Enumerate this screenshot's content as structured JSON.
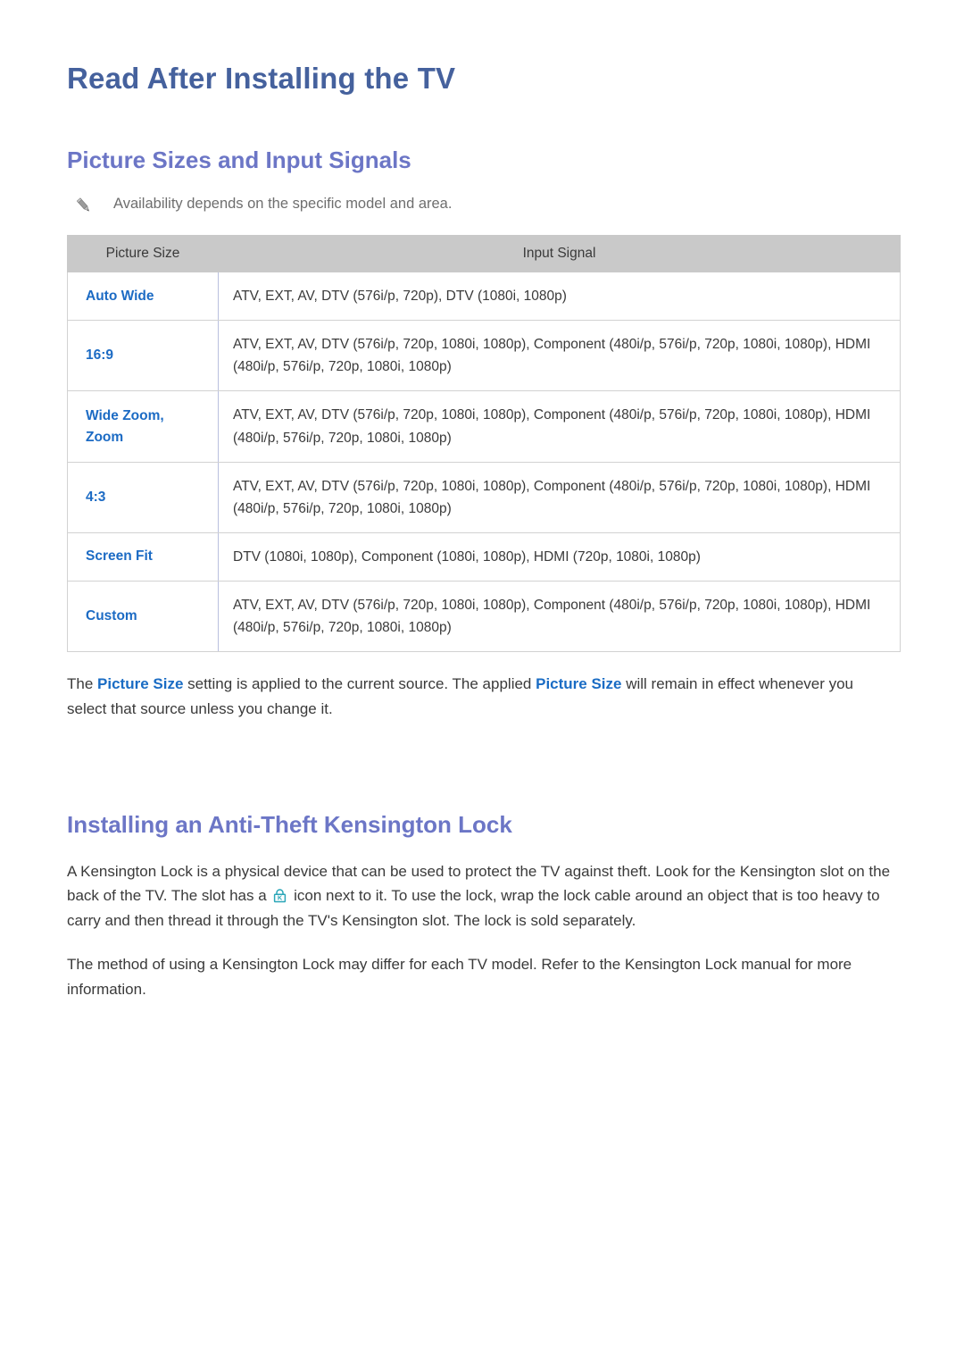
{
  "document": {
    "title": "Read After Installing the TV"
  },
  "sections": {
    "picture_sizes": {
      "heading": "Picture Sizes and Input Signals",
      "note": {
        "icon": "pencil-icon",
        "text": "Availability depends on the specific model and area."
      },
      "table": {
        "headers": [
          "Picture Size",
          "Input Signal"
        ],
        "rows": [
          {
            "size": "Auto Wide",
            "size_lines": [
              "Auto Wide"
            ],
            "signal": "ATV, EXT, AV, DTV (576i/p, 720p), DTV (1080i, 1080p)"
          },
          {
            "size": "16:9",
            "size_lines": [
              "16:9"
            ],
            "signal": "ATV, EXT, AV, DTV (576i/p, 720p, 1080i, 1080p), Component (480i/p, 576i/p, 720p, 1080i, 1080p), HDMI (480i/p, 576i/p, 720p, 1080i, 1080p)"
          },
          {
            "size": "Wide Zoom, Zoom",
            "size_lines": [
              "Wide Zoom,",
              "Zoom"
            ],
            "signal": "ATV, EXT, AV, DTV (576i/p, 720p, 1080i, 1080p), Component (480i/p, 576i/p, 720p, 1080i, 1080p), HDMI (480i/p, 576i/p, 720p, 1080i, 1080p)"
          },
          {
            "size": "4:3",
            "size_lines": [
              "4:3"
            ],
            "signal": "ATV, EXT, AV, DTV (576i/p, 720p, 1080i, 1080p), Component (480i/p, 576i/p, 720p, 1080i, 1080p), HDMI (480i/p, 576i/p, 720p, 1080i, 1080p)"
          },
          {
            "size": "Screen Fit",
            "size_lines": [
              "Screen Fit"
            ],
            "signal": "DTV (1080i, 1080p), Component (1080i, 1080p), HDMI (720p, 1080i, 1080p)"
          },
          {
            "size": "Custom",
            "size_lines": [
              "Custom"
            ],
            "signal": "ATV, EXT, AV, DTV (576i/p, 720p, 1080i, 1080p), Component (480i/p, 576i/p, 720p, 1080i, 1080p), HDMI (480i/p, 576i/p, 720p, 1080i, 1080p)"
          }
        ]
      },
      "paragraph": {
        "part1": "The ",
        "highlight1": "Picture Size",
        "part2": " setting is applied to the current source. The applied ",
        "highlight2": "Picture Size",
        "part3": " will remain in effect whenever you select that source unless you change it."
      }
    },
    "kensington": {
      "heading": "Installing an Anti-Theft Kensington Lock",
      "paragraph1": {
        "part1": "A Kensington Lock is a physical device that can be used to protect the TV against theft. Look for the Kensington slot on the back of the TV. The slot has a ",
        "icon": "kensington-lock-icon",
        "part2": " icon next to it. To use the lock, wrap the lock cable around an object that is too heavy to carry and then thread it through the TV's Kensington slot. The lock is sold separately."
      },
      "paragraph2": "The method of using a Kensington Lock may differ for each TV model. Refer to the Kensington Lock manual for more information."
    }
  },
  "colors": {
    "doc_title": "#45619d",
    "section_title": "#6c76c6",
    "table_header_bg": "#c9c9c9",
    "link_blue": "#1c6bc4",
    "note_gray": "#6e6e6e",
    "lock_icon": "#2aa6b8"
  }
}
